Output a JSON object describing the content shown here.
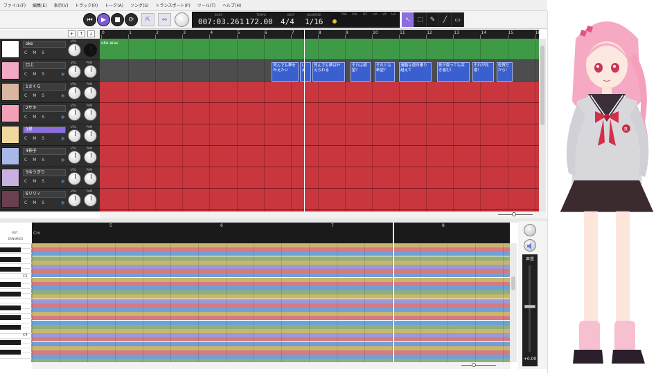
{
  "menu": {
    "items": [
      "ファイル(F)",
      "編集(E)",
      "表示(V)",
      "トラック(R)",
      "トーク(A)",
      "ソング(S)",
      "トランスポート(P)",
      "ツール(T)",
      "ヘルプ(H)"
    ]
  },
  "transport": {
    "bars_label": "BARS",
    "position": "007:03.261",
    "tempo_label": "TEMPO",
    "tempo": "172.00",
    "beat_label": "BEAT",
    "beat": "4/4",
    "quantize_label": "QUANTIZE",
    "quantize": "1/16",
    "meter_labels": [
      "TMG",
      "VOL",
      "PIT",
      "VIA",
      "VIP",
      "ALP"
    ],
    "tools": [
      "select-tool",
      "range-tool",
      "pencil-tool",
      "line-tool",
      "eraser-tool"
    ]
  },
  "ruler": {
    "ticks": [
      "0",
      "1",
      "2",
      "3",
      "4",
      "5",
      "6",
      "7",
      "8",
      "9",
      "10",
      "11",
      "12",
      "13",
      "14",
      "15",
      "16"
    ]
  },
  "track_controls": {
    "vol_label": "VOL",
    "pan_label": "PAN",
    "button_labels": [
      "C",
      "M",
      "S"
    ]
  },
  "tracks": [
    {
      "name": "oke",
      "type": "audio",
      "selected": false,
      "thumb_color": "#ffffff"
    },
    {
      "name": "口上",
      "type": "lyric",
      "selected": false,
      "thumb_color": "#f3a9c4"
    },
    {
      "name": "1さくら",
      "type": "vocal",
      "selected": false,
      "thumb_color": "#d9b6a0"
    },
    {
      "name": "2サキ",
      "type": "vocal",
      "selected": false,
      "thumb_color": "#f2a0b8"
    },
    {
      "name": "3星",
      "type": "vocal",
      "selected": true,
      "thumb_color": "#f0d9a0"
    },
    {
      "name": "4神子",
      "type": "vocal",
      "selected": false,
      "thumb_color": "#a8b8e8"
    },
    {
      "name": "5ゆうぎり",
      "type": "vocal",
      "selected": false,
      "thumb_color": "#c8b0e0"
    },
    {
      "name": "6リリィ",
      "type": "vocal",
      "selected": false,
      "thumb_color": "#6a4050"
    }
  ],
  "audio_clip": {
    "name": "oke.wav"
  },
  "lyric_notes": [
    {
      "text": "死んでも夢を叶えたい",
      "start": 6.3,
      "end": 7.3
    },
    {
      "text": "い え",
      "start": 7.35,
      "end": 7.75
    },
    {
      "text": "死んでも夢は叶えられる",
      "start": 7.8,
      "end": 9.0
    },
    {
      "text": "それは絶望?",
      "start": 9.2,
      "end": 9.95
    },
    {
      "text": "それとも希望?",
      "start": 10.1,
      "end": 10.85
    },
    {
      "text": "過酷な運命乗り越えて",
      "start": 11.0,
      "end": 12.2
    },
    {
      "text": "鉄が腐っても突き進む!",
      "start": 12.4,
      "end": 13.6
    },
    {
      "text": "それが私達!",
      "start": 13.7,
      "end": 14.5
    },
    {
      "text": "佐賀だから!",
      "start": 14.6,
      "end": 15.2
    }
  ],
  "playhead_bar": 7.5,
  "piano_roll": {
    "key_label": "KEY",
    "dynamics_label": "DYNAMICS",
    "chord_label": "Cm",
    "bar_ticks": [
      "5",
      "6",
      "7",
      "8"
    ],
    "octave_labels": [
      "C5",
      "C4"
    ]
  },
  "mixer": {
    "label": "声質",
    "value": "+0.00"
  },
  "colors": {
    "audio_track": "#3f9a47",
    "vocal_track": "#c9363d",
    "lyric_note": "#3a5fcf",
    "accent": "#7b5bd1",
    "stripe_gold": "#c9b56d",
    "stripe_pink": "#d77a80",
    "stripe_blue": "#6fa0d8",
    "stripe_green": "#8fb07a"
  }
}
